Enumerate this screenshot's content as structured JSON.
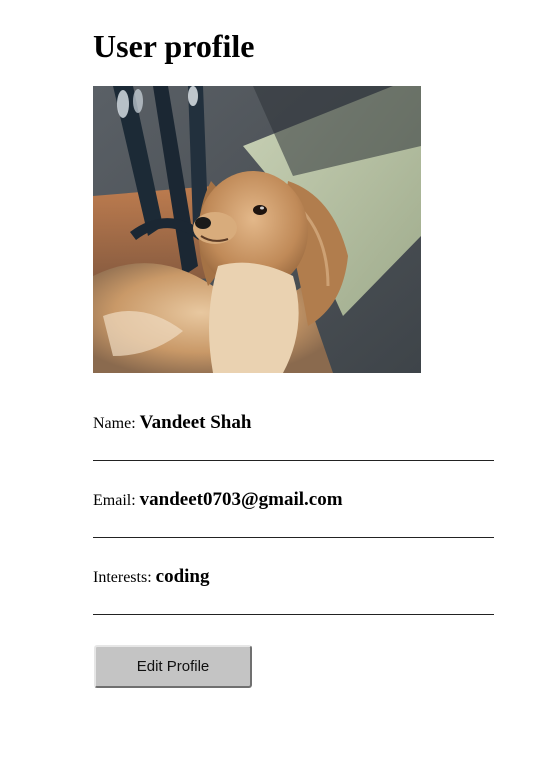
{
  "page": {
    "title": "User profile"
  },
  "profile": {
    "photo_alt": "dog",
    "fields": [
      {
        "label": "Name: ",
        "value": "Vandeet Shah"
      },
      {
        "label": "Email: ",
        "value": "vandeet0703@gmail.com"
      },
      {
        "label": "Interests: ",
        "value": "coding"
      }
    ]
  },
  "actions": {
    "edit_label": "Edit Profile"
  }
}
